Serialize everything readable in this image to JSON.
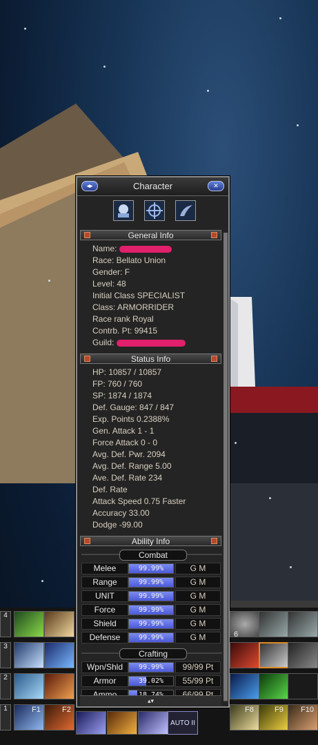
{
  "window": {
    "title": "Character",
    "tabs": [
      "character-icon",
      "crosshair-icon",
      "claw-icon"
    ]
  },
  "general_info": {
    "header": "General Info",
    "name_label": "Name:",
    "race": "Race: Bellato Union",
    "gender": "Gender: F",
    "level": "Level: 48",
    "initial_class": "Initial Class SPECIALIST",
    "class": "Class: ARMORRIDER",
    "race_rank": "Race rank Royal",
    "contrb_pt": "Contrb. Pt: 99415",
    "guild_label": "Guild:"
  },
  "status_info": {
    "header": "Status Info",
    "lines": [
      "HP: 10857 / 10857",
      "FP: 760 / 760",
      "SP: 1874 / 1874",
      "Def. Gauge: 847 / 847",
      "Exp. Points 0.2388%",
      "Gen. Attack 1 - 1",
      "Force Attack 0 - 0",
      "Avg. Def. Pwr. 2094",
      "Avg. Def. Range 5.00",
      "Ave. Def. Rate 234",
      "Def. Rate",
      "Attack Speed 0.75 Faster",
      "Accuracy 33.00",
      "Dodge -99.00"
    ]
  },
  "ability_info": {
    "header": "Ability Info",
    "combat_label": "Combat",
    "combat": [
      {
        "name": "Melee",
        "pct": "99.99%",
        "level": 0.9999,
        "grade": "G M"
      },
      {
        "name": "Range",
        "pct": "99.99%",
        "level": 0.9999,
        "grade": "G M"
      },
      {
        "name": "UNIT",
        "pct": "99.99%",
        "level": 0.9999,
        "grade": "G M"
      },
      {
        "name": "Force",
        "pct": "99.99%",
        "level": 0.9999,
        "grade": "G M"
      },
      {
        "name": "Shield",
        "pct": "99.99%",
        "level": 0.9999,
        "grade": "G M"
      },
      {
        "name": "Defense",
        "pct": "99.99%",
        "level": 0.9999,
        "grade": "G M"
      }
    ],
    "crafting_label": "Crafting",
    "crafting": [
      {
        "name": "Wpn/Shld",
        "pct": "99.99%",
        "level": 0.9999,
        "points": "99/99 Pt"
      },
      {
        "name": "Armor",
        "pct": "39.02%",
        "level": 0.3902,
        "points": "55/99 Pt"
      },
      {
        "name": "Ammo",
        "pct": "18.74%",
        "level": 0.1874,
        "points": "66/99 Pt"
      }
    ]
  },
  "hotbar": {
    "fkeys": [
      "F1",
      "F2",
      "F8",
      "F9",
      "F10"
    ],
    "slot_number": "6",
    "row_numbers": [
      "4",
      "3",
      "2",
      "1"
    ],
    "auto_label": "AUTO II"
  }
}
